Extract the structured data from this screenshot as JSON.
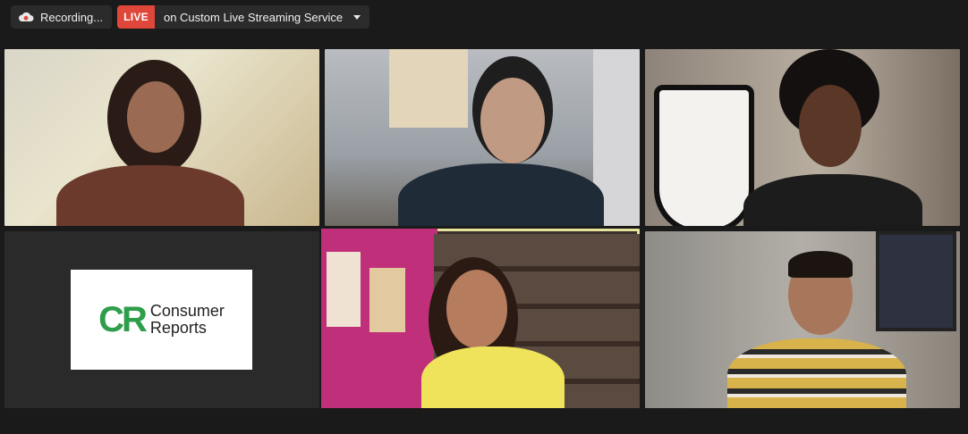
{
  "toolbar": {
    "recording_label": "Recording...",
    "live_badge": "LIVE",
    "live_destination": "on Custom Live Streaming Service",
    "icons": {
      "recording": "cloud-record-icon",
      "dropdown": "chevron-down-icon"
    },
    "colors": {
      "live_red": "#e0473b",
      "pill_bg": "#2b2b2b"
    }
  },
  "gallery": {
    "active_speaker_highlight": "#e6e49a",
    "tiles": [
      {
        "id": "participant-1",
        "type": "video"
      },
      {
        "id": "participant-2",
        "type": "video"
      },
      {
        "id": "participant-3",
        "type": "video"
      },
      {
        "id": "participant-4",
        "type": "logo",
        "logo": {
          "mark": "CR",
          "line1": "Consumer",
          "line2": "Reports"
        },
        "brand_color": "#2e9e4a"
      },
      {
        "id": "participant-5",
        "type": "video",
        "active_speaker": true
      },
      {
        "id": "participant-6",
        "type": "video"
      }
    ]
  }
}
